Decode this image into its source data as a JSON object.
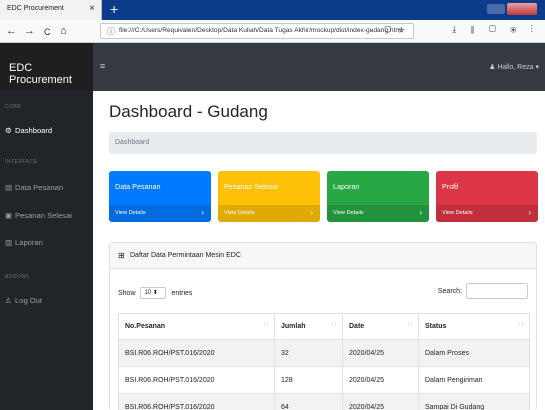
{
  "browser": {
    "tab_title": "EDC Procurement",
    "tab_close": "×",
    "new_tab": "+",
    "url": "file:///C:/Users/Requivalen/Desktop/Data Kuliah/Data Tugas Akhir/mockup/dist/index-gudang.html",
    "url_actions": "··· ⛉ ☆",
    "toolbar_icons": "⤓ ⫴ ▢ ⦿ ⋮",
    "back": "←",
    "forward": "→",
    "reload": "C",
    "home": "⌂"
  },
  "app": {
    "brand": "EDC Procurement",
    "menu_toggle": "≡",
    "user": "Hallo, Reza"
  },
  "sidebar": {
    "headings": [
      "CORE",
      "INTERFACE",
      "ADDONS"
    ],
    "items": [
      {
        "label": "Dashboard",
        "icon": "⚙"
      },
      {
        "label": "Data Pesanan",
        "icon": "▤"
      },
      {
        "label": "Pesanan Selesai",
        "icon": "▣"
      },
      {
        "label": "Laporan",
        "icon": "▥"
      },
      {
        "label": "Log Out",
        "icon": "♙"
      }
    ]
  },
  "main": {
    "title": "Dashboard - Gudang",
    "breadcrumb": "Dashboard",
    "cards": [
      {
        "title": "Data Pesanan",
        "link": "View Details",
        "color": "#007bff"
      },
      {
        "title": "Pesanan Selesai",
        "link": "View Details",
        "color": "#ffc107"
      },
      {
        "title": "Laporan",
        "link": "View Details",
        "color": "#28a745"
      },
      {
        "title": "Profil",
        "link": "View Details",
        "color": "#dc3545"
      }
    ],
    "card_arrow": "›",
    "panel_title": "Daftar Data Permintaan Mesin EDC",
    "show_label": "Show",
    "show_value": "10",
    "entries_label": "entries",
    "search_label": "Search:",
    "table": {
      "headers": [
        "No.Pesanan",
        "Jumlah",
        "Date",
        "Status"
      ],
      "rows": [
        [
          "BSI.R06.ROH/PST.016/2020",
          "32",
          "2020/04/25",
          "Dalam Proses"
        ],
        [
          "BSI.R06.ROH/PST.016/2020",
          "128",
          "2020/04/25",
          "Dalam Pengiriman"
        ],
        [
          "BSI.R06.ROH/PST.016/2020",
          "64",
          "2020/04/25",
          "Sampai Di Gudang"
        ]
      ]
    }
  }
}
